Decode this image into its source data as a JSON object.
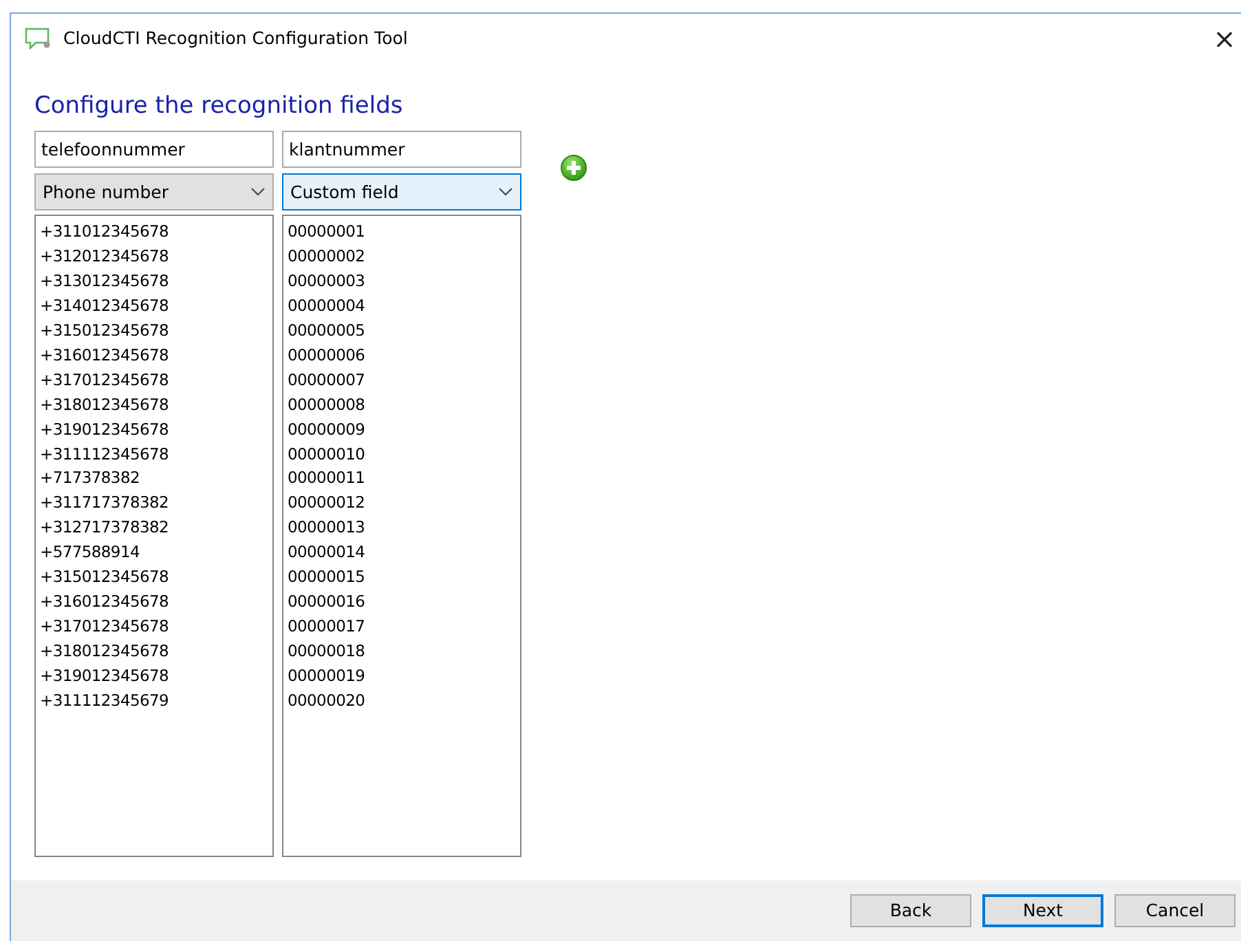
{
  "window": {
    "title": "CloudCTI Recognition Configuration Tool",
    "close": "×"
  },
  "heading": "Configure the recognition fields",
  "columns": [
    {
      "name": "telefoonnummer",
      "type": "Phone number",
      "focused": false,
      "values": [
        "+311012345678",
        "+312012345678",
        "+313012345678",
        "+314012345678",
        "+315012345678",
        "+316012345678",
        "+317012345678",
        "+318012345678",
        "+319012345678",
        "+311112345678",
        "+717378382",
        "+311717378382",
        "+312717378382",
        "+577588914",
        "+315012345678",
        "+316012345678",
        "+317012345678",
        "+318012345678",
        "+319012345678",
        "+311112345679"
      ]
    },
    {
      "name": "klantnummer",
      "type": "Custom field",
      "focused": true,
      "values": [
        "00000001",
        "00000002",
        "00000003",
        "00000004",
        "00000005",
        "00000006",
        "00000007",
        "00000008",
        "00000009",
        "00000010",
        "00000011",
        "00000012",
        "00000013",
        "00000014",
        "00000015",
        "00000016",
        "00000017",
        "00000018",
        "00000019",
        "00000020"
      ]
    }
  ],
  "buttons": [
    {
      "label": "Back",
      "default": false
    },
    {
      "label": "Next",
      "default": true
    },
    {
      "label": "Cancel",
      "default": false
    }
  ]
}
